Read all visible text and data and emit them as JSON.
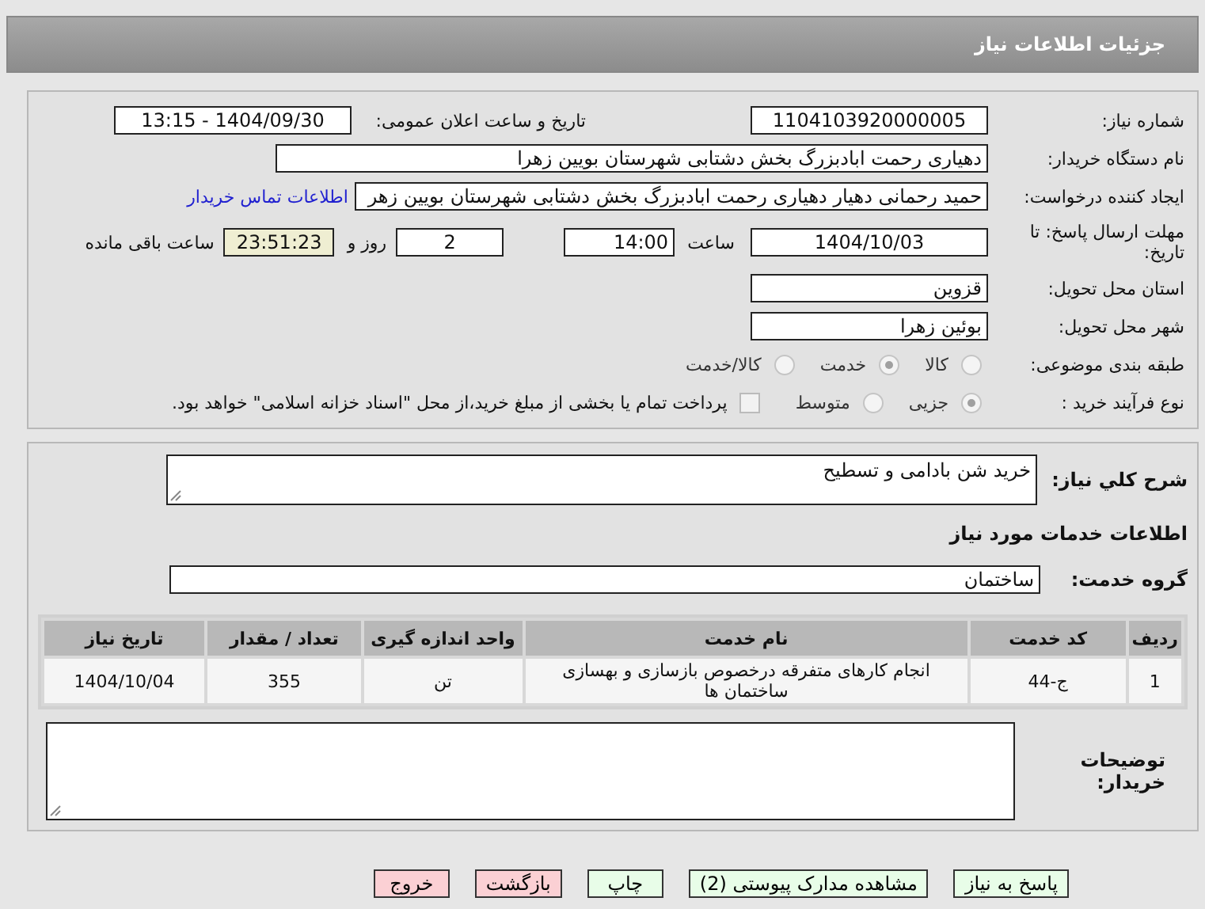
{
  "header": {
    "title": "جزئیات اطلاعات نیاز"
  },
  "need_number": {
    "label": "شماره نیاز:",
    "value": "1104103920000005"
  },
  "announce": {
    "label": "تاریخ و ساعت اعلان عمومی:",
    "value": "1404/09/30 - 13:15"
  },
  "buyer_org": {
    "label": "نام دستگاه خریدار:",
    "value": "دهیاری رحمت ابادبزرگ بخش دشتابی شهرستان بویین زهرا"
  },
  "creator": {
    "label": "ایجاد کننده درخواست:",
    "value": "حمید رحمانی دهیار دهیاری رحمت ابادبزرگ بخش دشتابی شهرستان بویین زهر",
    "link": "اطلاعات تماس خریدار"
  },
  "deadline": {
    "label": "مهلت ارسال پاسخ: تا تاریخ:",
    "date": "1404/10/03",
    "time_label": "ساعت",
    "time": "14:00",
    "days": "2",
    "days_label": "روز و",
    "remaining": "23:51:23",
    "remaining_label": "ساعت باقی مانده"
  },
  "province": {
    "label": "استان محل تحویل:",
    "value": "قزوین"
  },
  "city": {
    "label": "شهر محل تحویل:",
    "value": "بوئین زهرا"
  },
  "category": {
    "label": "طبقه بندی موضوعی:",
    "disabled": true,
    "options": [
      {
        "label": "کالا",
        "selected": false
      },
      {
        "label": "خدمت",
        "selected": true
      },
      {
        "label": "کالا/خدمت",
        "selected": false
      }
    ]
  },
  "process": {
    "label": "نوع فرآیند خرید :",
    "disabled": true,
    "options": [
      {
        "label": "جزیی",
        "selected": true
      },
      {
        "label": "متوسط",
        "selected": false
      }
    ],
    "treasury": {
      "label": "پرداخت تمام یا بخشی از مبلغ خرید،از محل \"اسناد خزانه اسلامی\" خواهد بود.",
      "checked": false
    }
  },
  "description": {
    "label": "شرح کلي نياز:",
    "value": "خرید شن بادامی و تسطیح"
  },
  "services_title": "اطلاعات خدمات مورد نیاز",
  "service_group": {
    "label": "گروه خدمت:",
    "value": "ساختمان"
  },
  "table": {
    "columns": [
      "ردیف",
      "کد خدمت",
      "نام خدمت",
      "واحد اندازه گیری",
      "تعداد / مقدار",
      "تاریخ نیاز"
    ],
    "rows": [
      [
        "1",
        "ج-44",
        "انجام کارهای متفرقه درخصوص بازسازی و بهسازی ساختمان ها",
        "تن",
        "355",
        "1404/10/04"
      ]
    ]
  },
  "buyer_notes": {
    "label": "توضیحات خریدار:"
  },
  "buttons": [
    {
      "label": "پاسخ به نیاز",
      "kind": "normal"
    },
    {
      "label": "مشاهده مدارک پیوستی (2)",
      "kind": "normal"
    },
    {
      "label": "چاپ",
      "kind": "normal"
    },
    {
      "label": "بازگشت",
      "kind": "danger"
    },
    {
      "label": "خروج",
      "kind": "danger"
    }
  ]
}
